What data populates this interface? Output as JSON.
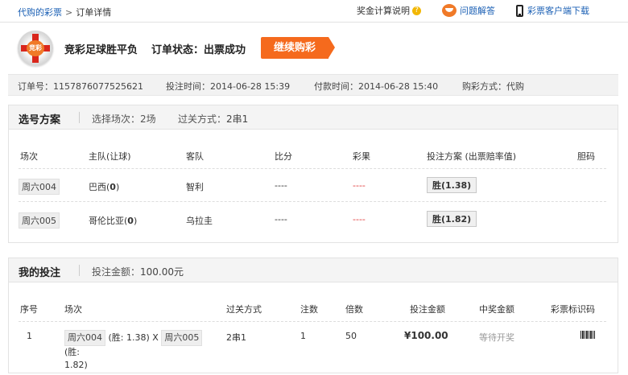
{
  "breadcrumb": {
    "link": "代购的彩票",
    "separator": ">",
    "current": "订单详情"
  },
  "top_links": {
    "bonus_rules": "奖金计算说明",
    "faq": "问题解答",
    "client_download": "彩票客户端下载"
  },
  "header": {
    "logo_text": "竞彩",
    "title": "竞彩足球胜平负",
    "status_label": "订单状态：",
    "status_value": "出票成功",
    "continue_button": "继续购彩"
  },
  "order_info": {
    "order_no": "订单号：1157876077525621",
    "bet_time": "投注时间：2014-06-28 15:39",
    "pay_time": "付款时间：2014-06-28 15:40",
    "buy_method": "购彩方式：代购"
  },
  "selection": {
    "title": "选号方案",
    "match_count_label": "选择场次：",
    "match_count": "2场",
    "pass_type_label": "过关方式：",
    "pass_type": "2串1",
    "columns": [
      "场次",
      "主队(让球)",
      "客队",
      "比分",
      "彩果",
      "投注方案 (出票赔率值)",
      "胆码"
    ],
    "rows": [
      {
        "match": "周六004",
        "home": "巴西(",
        "handicap": "0",
        "home_close": ")",
        "away": "智利",
        "score": "----",
        "result": "----",
        "bet": "胜(1.38)",
        "banker": ""
      },
      {
        "match": "周六005",
        "home": "哥伦比亚(",
        "handicap": "0",
        "home_close": ")",
        "away": "乌拉圭",
        "score": "----",
        "result": "----",
        "bet": "胜(1.82)",
        "banker": ""
      }
    ]
  },
  "my_bet": {
    "title": "我的投注",
    "amount_label": "投注金额：",
    "amount": "100.00元",
    "columns": [
      "序号",
      "场次",
      "过关方式",
      "注数",
      "倍数",
      "投注金额",
      "中奖金额",
      "彩票标识码"
    ],
    "rows": [
      {
        "seq": "1",
        "match1": "周六004",
        "match1_odds": "(胜: 1.38)",
        "cross": "X",
        "match2": "周六005",
        "match2_odds_a": "(胜:",
        "match2_odds_b": "1.82)",
        "pass": "2串1",
        "bets": "1",
        "multiple": "50",
        "amount": "¥100.00",
        "prize": "等待开奖",
        "ticket_icon": "barcode-icon"
      }
    ]
  },
  "colors": {
    "accent": "#f56a1d",
    "link": "#1a5fb4",
    "result_red": "#e23b3b"
  }
}
